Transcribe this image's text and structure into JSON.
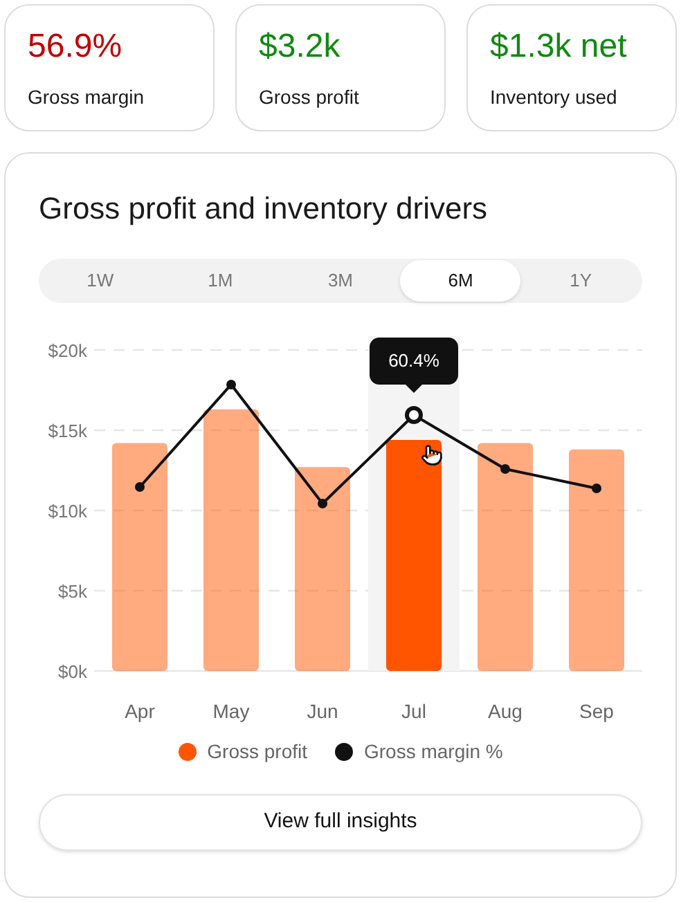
{
  "kpis": [
    {
      "value": "56.9%",
      "label": "Gross margin",
      "color": "#c00000"
    },
    {
      "value": "$3.2k",
      "label": "Gross profit",
      "color": "#108a10"
    },
    {
      "value": "$1.3k net",
      "label": "Inventory used",
      "color": "#108a10"
    }
  ],
  "card": {
    "title": "Gross profit and inventory drivers",
    "tabs": [
      {
        "label": "1W",
        "selected": false
      },
      {
        "label": "1M",
        "selected": false
      },
      {
        "label": "3M",
        "selected": false
      },
      {
        "label": "6M",
        "selected": true
      },
      {
        "label": "1Y",
        "selected": false
      }
    ],
    "chart_data": {
      "type": "bar",
      "categories": [
        "Apr",
        "May",
        "Jun",
        "Jul",
        "Aug",
        "Sep"
      ],
      "series": [
        {
          "name": "Gross profit",
          "color": "#ff5500",
          "values": [
            14.2,
            16.3,
            12.7,
            14.4,
            14.2,
            13.8
          ]
        }
      ],
      "ylim": [
        0,
        20
      ],
      "yticks": [
        {
          "value": 0,
          "label": "$0k"
        },
        {
          "value": 5,
          "label": "$5k"
        },
        {
          "value": 10,
          "label": "$10k"
        },
        {
          "value": 15,
          "label": "$15k"
        },
        {
          "value": 20,
          "label": "$20k"
        }
      ],
      "grid": true,
      "bands": [
        {
          "axis": "x",
          "from": "Jul",
          "to": "Jul"
        }
      ],
      "annotations": [
        "60.4%"
      ]
    },
    "line_legend": {
      "name": "Gross margin %",
      "color": "#111111"
    },
    "button": "View full insights"
  }
}
